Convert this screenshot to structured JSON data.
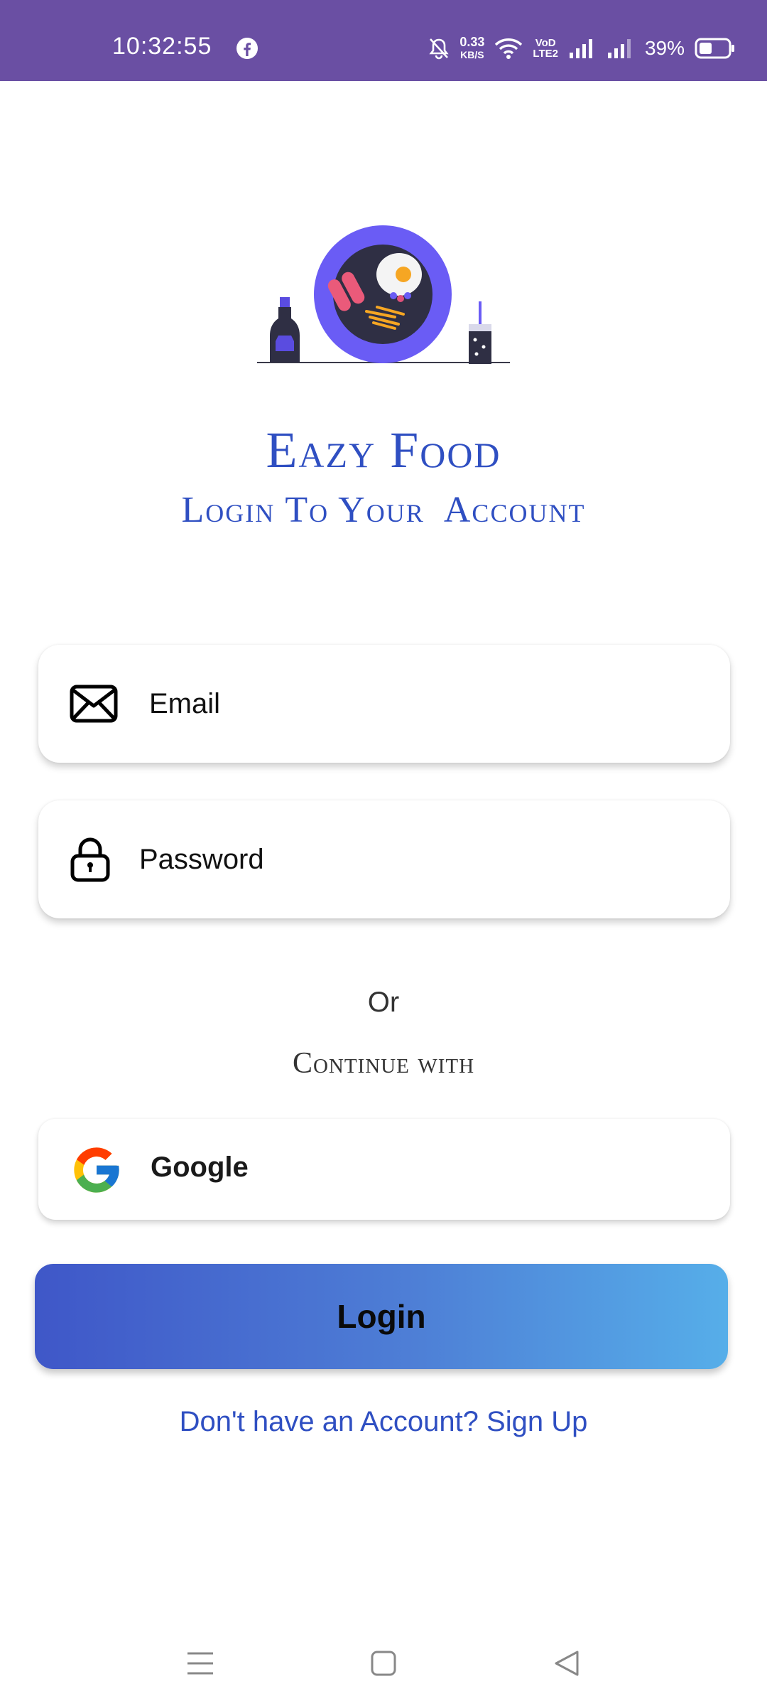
{
  "status_bar": {
    "time": "10:32:55",
    "net_speed_value": "0.33",
    "net_speed_unit": "KB/S",
    "volte_top": "VoD",
    "volte_bottom": "LTE2",
    "battery": "39%",
    "icons": [
      "facebook-icon",
      "mute-icon",
      "wifi-icon",
      "signal-icon",
      "signal-icon",
      "battery-icon"
    ]
  },
  "header": {
    "title": "Eazy Food",
    "subtitle": "Login To Your  Account"
  },
  "form": {
    "email_placeholder": "Email",
    "password_placeholder": "Password"
  },
  "divider": {
    "or_label": "Or",
    "continue_label": "Continue with"
  },
  "google": {
    "label": "Google"
  },
  "login": {
    "label": "Login"
  },
  "signup": {
    "label": "Don't have an Account? Sign Up"
  },
  "colors": {
    "status_bar": "#6a4fa3",
    "accent": "#2f4fc2",
    "gradient_start": "#3f57c8",
    "gradient_end": "#56aee9"
  }
}
